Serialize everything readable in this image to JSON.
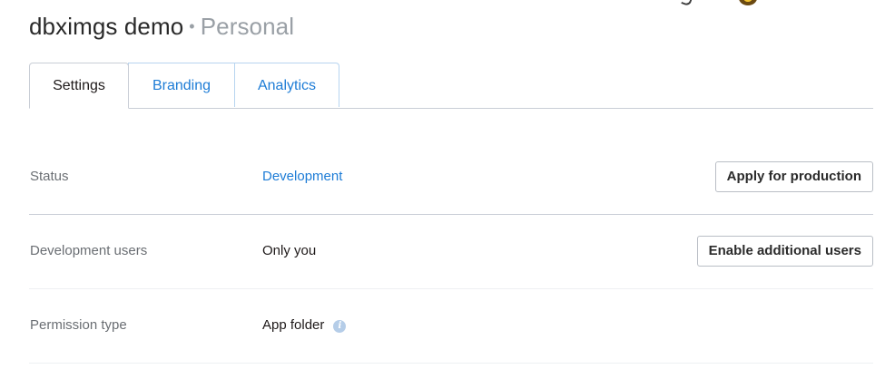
{
  "header": {
    "app_name": "dbximgs demo",
    "separator": "•",
    "account_type": "Personal"
  },
  "tabs": [
    {
      "label": "Settings",
      "active": true
    },
    {
      "label": "Branding",
      "active": false
    },
    {
      "label": "Analytics",
      "active": false
    }
  ],
  "rows": {
    "status": {
      "label": "Status",
      "value": "Development",
      "button": "Apply for production"
    },
    "dev_users": {
      "label": "Development users",
      "value": "Only you",
      "button": "Enable additional users"
    },
    "permission": {
      "label": "Permission type",
      "value": "App folder",
      "info_icon": "i"
    }
  },
  "colors": {
    "link_blue": "#1d7cd6",
    "label_gray": "#6a6e73",
    "divider": "#c9ced6"
  }
}
